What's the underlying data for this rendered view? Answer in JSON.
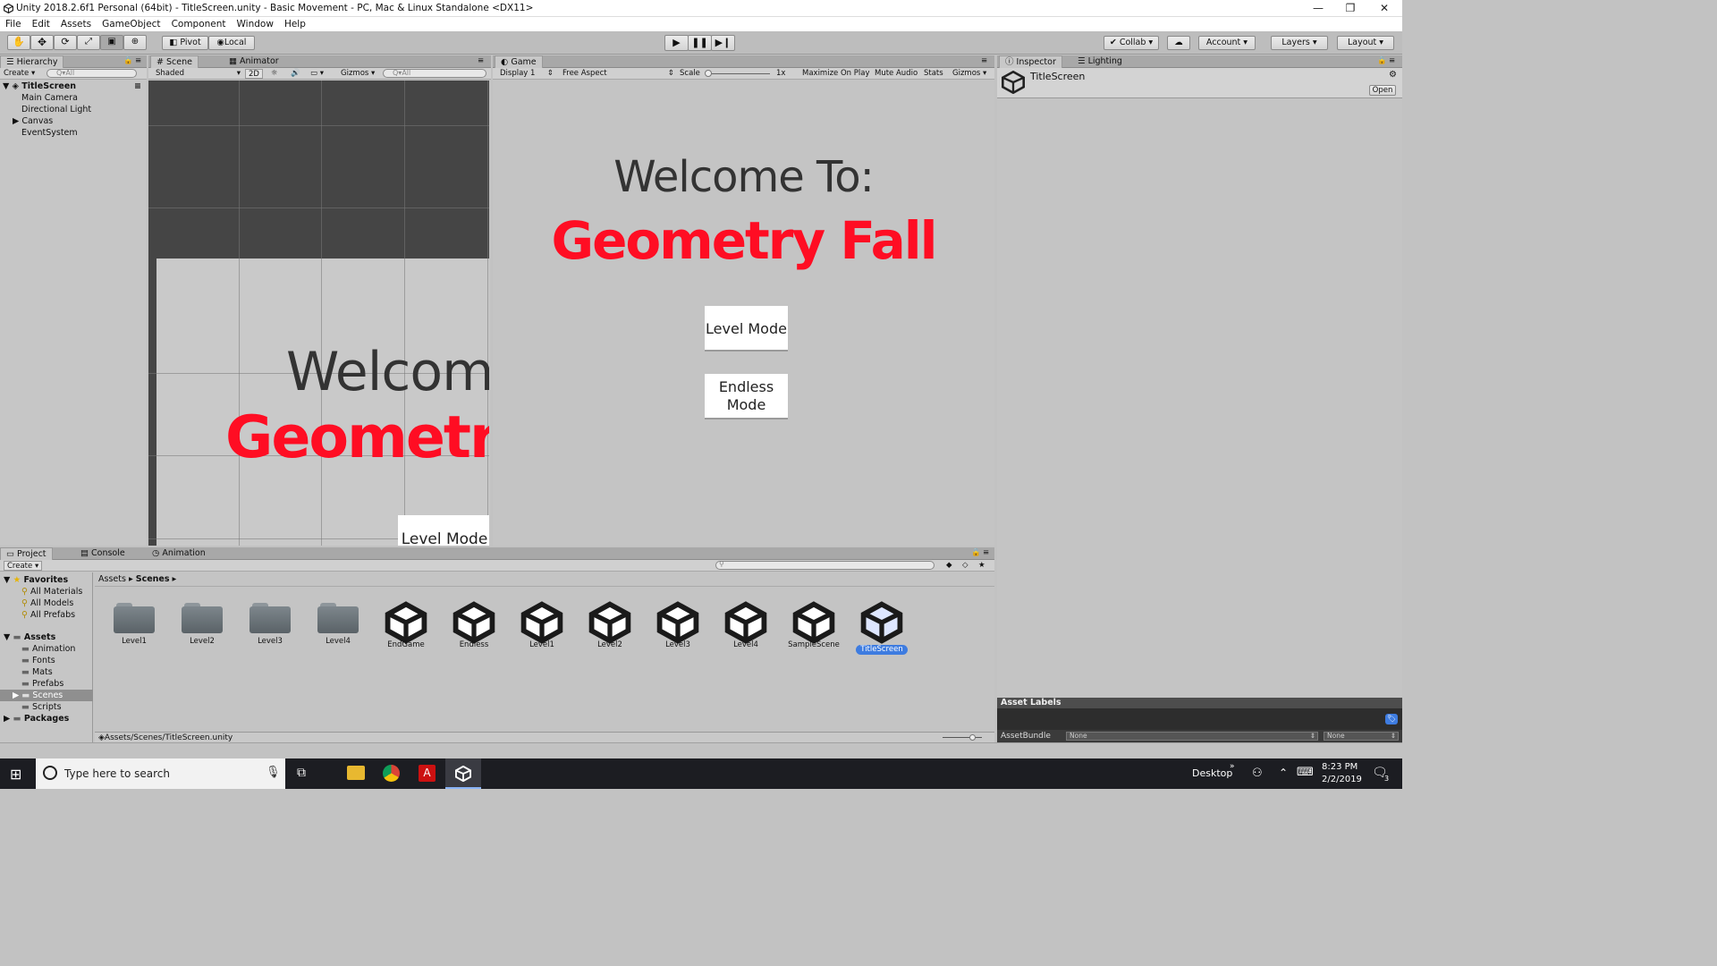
{
  "window": {
    "title": "Unity 2018.2.6f1 Personal (64bit) - TitleScreen.unity - Basic Movement - PC, Mac & Linux Standalone <DX11>",
    "controls": [
      "—",
      "❐",
      "✕"
    ]
  },
  "menu": [
    "File",
    "Edit",
    "Assets",
    "GameObject",
    "Component",
    "Window",
    "Help"
  ],
  "toolbar": {
    "pivot": "Pivot",
    "local": "Local",
    "collab": "Collab",
    "account": "Account",
    "layers": "Layers",
    "layout": "Layout"
  },
  "hierarchy": {
    "tab": "Hierarchy",
    "create": "Create",
    "search_placeholder": "Q▾All",
    "scene": "TitleScreen",
    "items": [
      "Main Camera",
      "Directional Light",
      "Canvas",
      "EventSystem"
    ]
  },
  "scene_view": {
    "tabs": [
      "Scene",
      "Animator"
    ],
    "shading": "Shaded",
    "mode_2d": "2D",
    "gizmos": "Gizmos",
    "search_placeholder": "Q▾All",
    "welcome_text": "Welcome",
    "title_text": "Geometr",
    "button_text": "Level Mode"
  },
  "game_view": {
    "tab": "Game",
    "display": "Display 1",
    "aspect": "Free Aspect",
    "scale_label": "Scale",
    "scale_value": "1x",
    "maximize": "Maximize On Play",
    "mute": "Mute Audio",
    "stats": "Stats",
    "gizmos": "Gizmos",
    "welcome": "Welcome To:",
    "title": "Geometry Fall",
    "level_mode": "Level Mode",
    "endless_mode": "Endless Mode"
  },
  "inspector": {
    "tabs": [
      "Inspector",
      "Lighting"
    ],
    "asset_name": "TitleScreen",
    "open_button": "Open",
    "asset_labels": "Asset Labels",
    "asset_bundle_label": "AssetBundle",
    "bundle_value": "None",
    "variant_value": "None"
  },
  "project": {
    "tabs": [
      "Project",
      "Console",
      "Animation"
    ],
    "create": "Create",
    "favorites": "Favorites",
    "favorites_items": [
      "All Materials",
      "All Models",
      "All Prefabs"
    ],
    "assets": "Assets",
    "asset_folders": [
      "Animation",
      "Fonts",
      "Mats",
      "Prefabs",
      "Scenes",
      "Scripts"
    ],
    "packages": "Packages",
    "breadcrumb": [
      "Assets",
      "Scenes"
    ],
    "folders": [
      "Level1",
      "Level2",
      "Level3",
      "Level4"
    ],
    "scenes": [
      "EndGame",
      "Endless",
      "Level1",
      "Level2",
      "Level3",
      "Level4",
      "SampleScene",
      "TitleScreen"
    ],
    "selected_scene": "TitleScreen",
    "status_path": "Assets/Scenes/TitleScreen.unity"
  },
  "taskbar": {
    "search_placeholder": "Type here to search",
    "desktop": "Desktop",
    "time": "8:23 PM",
    "date": "2/2/2019",
    "notification_count": "3"
  },
  "colors": {
    "title_red": "#ff0d23",
    "selected_blue": "#3e7ce0",
    "taskbar": "#1c1d22"
  }
}
